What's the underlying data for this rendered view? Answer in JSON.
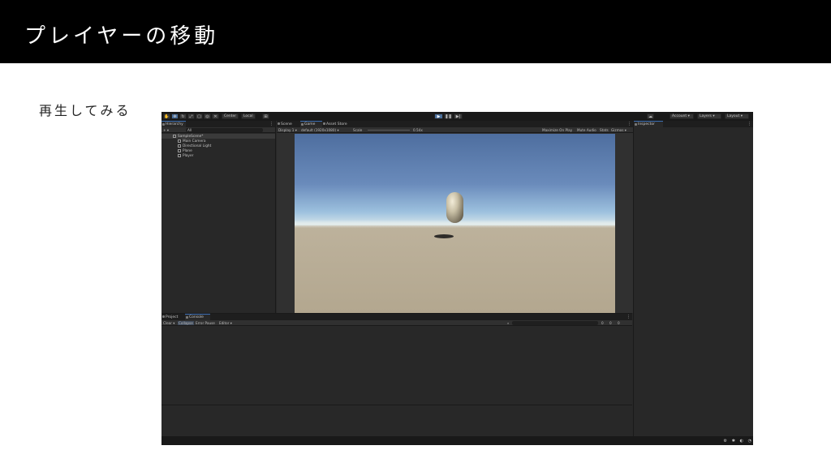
{
  "slide": {
    "title": "プレイヤーの移動",
    "subtitle": "再生してみる"
  },
  "toolbar": {
    "pivot_label": "Center",
    "space_label": "Local",
    "account_label": "Account ▾",
    "layers_label": "Layers ▾",
    "layout_label": "Layout ▾"
  },
  "hierarchy": {
    "tab_label": "Hierarchy",
    "search_placeholder": "All",
    "add_label": "+ ▾",
    "scene_name": "SampleScene*",
    "items": [
      {
        "label": "Main Camera"
      },
      {
        "label": "Directional Light"
      },
      {
        "label": "Plane"
      },
      {
        "label": "Player"
      }
    ]
  },
  "center_tabs": [
    {
      "label": "Scene"
    },
    {
      "label": "Game"
    },
    {
      "label": "Asset Store"
    }
  ],
  "game_bar": {
    "display": "Display 1 ▾",
    "resolution": "default (1920x1080) ▾",
    "scale_label": "Scale",
    "scale_value": "0.54x",
    "maximize": "Maximize On Play",
    "mute": "Mute Audio",
    "stats": "Stats",
    "gizmos": "Gizmos ▾"
  },
  "inspector": {
    "tab_label": "Inspector"
  },
  "bottom_tabs": [
    {
      "label": "Project"
    },
    {
      "label": "Console"
    }
  ],
  "console_bar": {
    "clear": "Clear ▾",
    "collapse": "Collapse",
    "error_pause": "Error Pause",
    "editor": "Editor ▾",
    "count_info": "0",
    "count_warn": "0",
    "count_error": "0"
  },
  "colors": {
    "play_active": "#4a6e9a",
    "panel_bg": "#282828",
    "toolbar_bg": "#191919"
  }
}
